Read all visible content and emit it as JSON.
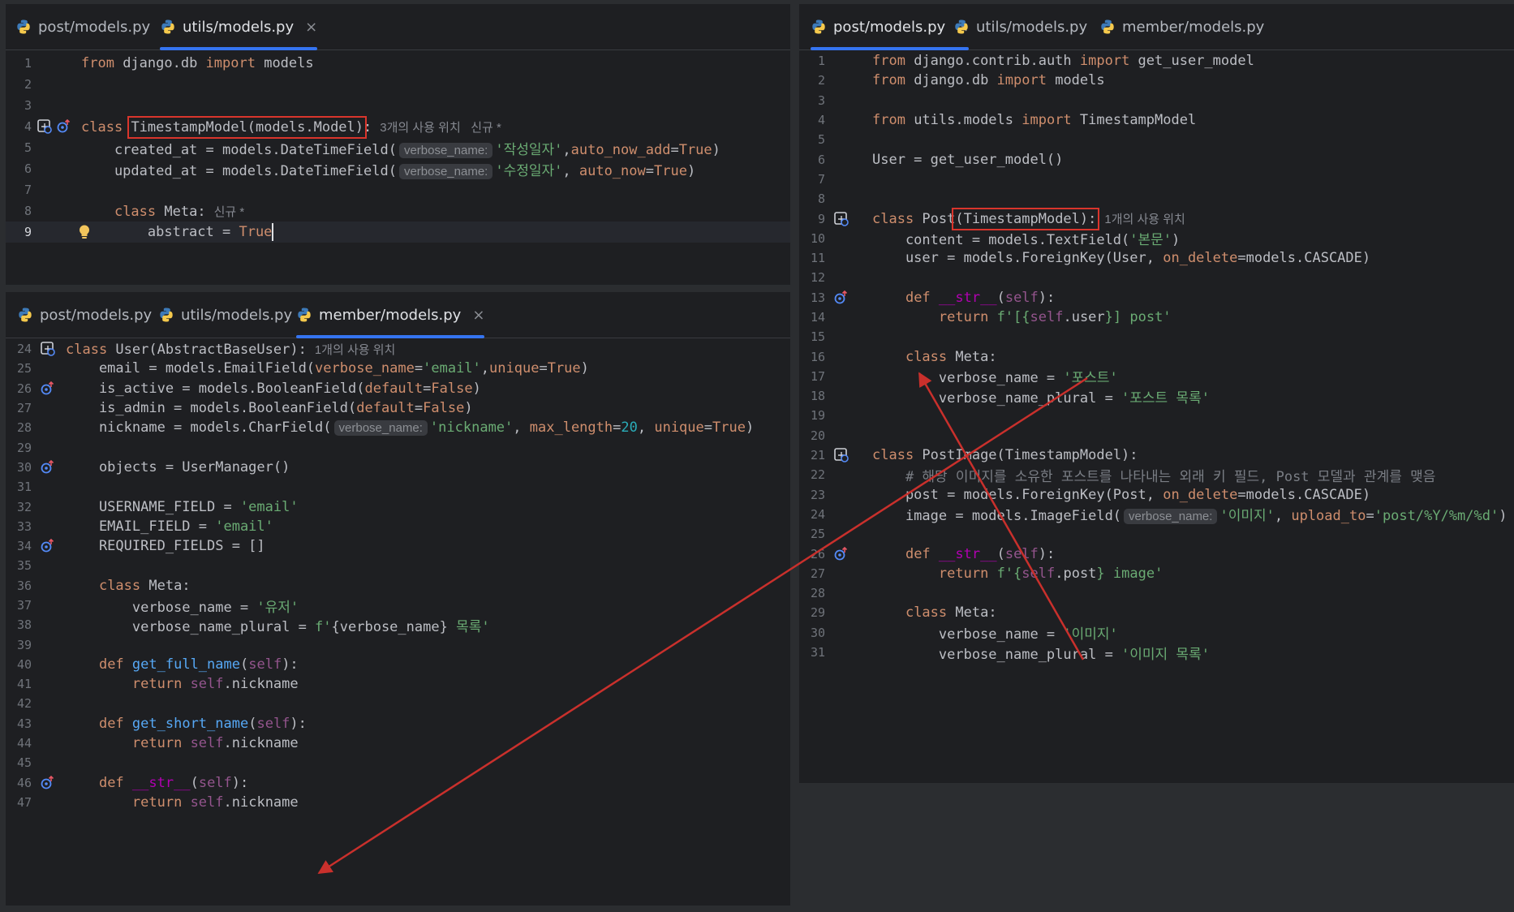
{
  "colors": {
    "accent": "#3574f0",
    "annotation_red": "#c9302c",
    "editor_bg": "#1e1f22",
    "keyword": "#cf8e6d",
    "string": "#6aab73"
  },
  "pane_a": {
    "tabs": [
      {
        "label": "post/models.py",
        "icon": "python-file-icon"
      },
      {
        "label": "utils/models.py",
        "icon": "python-file-icon",
        "close": "×"
      }
    ],
    "lines": [
      {
        "n": "1",
        "s": [
          {
            "t": "from",
            "c": "kw"
          },
          {
            "t": " django.db "
          },
          {
            "t": "import",
            "c": "kw"
          },
          {
            "t": " models"
          }
        ]
      },
      {
        "n": "2",
        "s": []
      },
      {
        "n": "3",
        "s": []
      },
      {
        "n": "4",
        "g": "structure",
        "s": [
          {
            "t": "class",
            "c": "kw"
          },
          {
            "t": " "
          },
          {
            "t": "TimestampModel(models.Model)",
            "hl": true
          },
          {
            "t": ":"
          },
          {
            "t": "3개의 사용 위치   신규 *",
            "c": "usage"
          }
        ]
      },
      {
        "n": "5",
        "s": [
          {
            "t": "    created_at = models.DateTimeField("
          },
          {
            "t": "verbose_name:",
            "c": "hint"
          },
          {
            "t": "'작성일자'",
            "c": "str"
          },
          {
            "t": ","
          },
          {
            "t": "auto_now_add",
            "c": "kw"
          },
          {
            "t": "="
          },
          {
            "t": "True",
            "c": "kw"
          },
          {
            "t": ")"
          }
        ]
      },
      {
        "n": "6",
        "s": [
          {
            "t": "    updated_at = models.DateTimeField("
          },
          {
            "t": "verbose_name:",
            "c": "hint"
          },
          {
            "t": "'수정일자'",
            "c": "str"
          },
          {
            "t": ", "
          },
          {
            "t": "auto_now",
            "c": "kw"
          },
          {
            "t": "="
          },
          {
            "t": "True",
            "c": "kw"
          },
          {
            "t": ")"
          }
        ]
      },
      {
        "n": "7",
        "s": []
      },
      {
        "n": "8",
        "s": [
          {
            "t": "    "
          },
          {
            "t": "class",
            "c": "kw"
          },
          {
            "t": " Meta:"
          },
          {
            "t": "신규 *",
            "c": "usage"
          }
        ]
      },
      {
        "n": "9",
        "current": true,
        "g": "bulb",
        "s": [
          {
            "t": "        abstract = "
          },
          {
            "t": "True",
            "c": "kw"
          },
          {
            "cursor": true
          }
        ]
      }
    ]
  },
  "pane_b": {
    "tabs": [
      {
        "label": "post/models.py",
        "icon": "python-file-icon"
      },
      {
        "label": "utils/models.py",
        "icon": "python-file-icon"
      },
      {
        "label": "member/models.py",
        "icon": "python-file-icon",
        "close": "×"
      }
    ],
    "lines": [
      {
        "n": "24",
        "g": "structure",
        "s": [
          {
            "t": "class",
            "c": "kw"
          },
          {
            "t": " User(AbstractBaseUser):"
          },
          {
            "t": "1개의 사용 위치",
            "c": "usage"
          }
        ]
      },
      {
        "n": "25",
        "s": [
          {
            "t": "    email = models.EmailField("
          },
          {
            "t": "verbose_name",
            "c": "kw"
          },
          {
            "t": "="
          },
          {
            "t": "'email'",
            "c": "str"
          },
          {
            "t": ","
          },
          {
            "t": "unique",
            "c": "kw"
          },
          {
            "t": "="
          },
          {
            "t": "True",
            "c": "kw"
          },
          {
            "t": ")"
          }
        ]
      },
      {
        "n": "26",
        "g": "override",
        "s": [
          {
            "t": "    is_active = models.BooleanField("
          },
          {
            "t": "default",
            "c": "kw"
          },
          {
            "t": "="
          },
          {
            "t": "False",
            "c": "kw"
          },
          {
            "t": ")"
          }
        ]
      },
      {
        "n": "27",
        "s": [
          {
            "t": "    is_admin = models.BooleanField("
          },
          {
            "t": "default",
            "c": "kw"
          },
          {
            "t": "="
          },
          {
            "t": "False",
            "c": "kw"
          },
          {
            "t": ")"
          }
        ]
      },
      {
        "n": "28",
        "s": [
          {
            "t": "    nickname = models.CharField("
          },
          {
            "t": "verbose_name:",
            "c": "hint"
          },
          {
            "t": "'nickname'",
            "c": "str"
          },
          {
            "t": ", "
          },
          {
            "t": "max_length",
            "c": "kw"
          },
          {
            "t": "="
          },
          {
            "t": "20",
            "c": "num"
          },
          {
            "t": ", "
          },
          {
            "t": "unique",
            "c": "kw"
          },
          {
            "t": "="
          },
          {
            "t": "True",
            "c": "kw"
          },
          {
            "t": ")"
          }
        ]
      },
      {
        "n": "29",
        "s": []
      },
      {
        "n": "30",
        "g": "override",
        "s": [
          {
            "t": "    objects = UserManager()"
          }
        ]
      },
      {
        "n": "31",
        "s": []
      },
      {
        "n": "32",
        "s": [
          {
            "t": "    USERNAME_FIELD = "
          },
          {
            "t": "'email'",
            "c": "str"
          }
        ]
      },
      {
        "n": "33",
        "s": [
          {
            "t": "    EMAIL_FIELD = "
          },
          {
            "t": "'email'",
            "c": "str"
          }
        ]
      },
      {
        "n": "34",
        "g": "override",
        "s": [
          {
            "t": "    REQUIRED_FIELDS = []"
          }
        ]
      },
      {
        "n": "35",
        "s": []
      },
      {
        "n": "36",
        "s": [
          {
            "t": "    "
          },
          {
            "t": "class",
            "c": "kw"
          },
          {
            "t": " Meta:"
          }
        ]
      },
      {
        "n": "37",
        "s": [
          {
            "t": "        verbose_name = "
          },
          {
            "t": "'유저'",
            "c": "str"
          }
        ]
      },
      {
        "n": "38",
        "s": [
          {
            "t": "        verbose_name_plural = "
          },
          {
            "t": "f'",
            "c": "str"
          },
          {
            "t": "{verbose_name}"
          },
          {
            "t": " 목록'",
            "c": "str"
          }
        ]
      },
      {
        "n": "39",
        "s": []
      },
      {
        "n": "40",
        "s": [
          {
            "t": "    "
          },
          {
            "t": "def",
            "c": "kw"
          },
          {
            "t": " "
          },
          {
            "t": "get_full_name",
            "c": "fn"
          },
          {
            "t": "("
          },
          {
            "t": "self",
            "c": "self"
          },
          {
            "t": "):"
          }
        ]
      },
      {
        "n": "41",
        "s": [
          {
            "t": "        "
          },
          {
            "t": "return",
            "c": "kw"
          },
          {
            "t": " "
          },
          {
            "t": "self",
            "c": "self"
          },
          {
            "t": ".nickname"
          }
        ]
      },
      {
        "n": "42",
        "s": []
      },
      {
        "n": "43",
        "s": [
          {
            "t": "    "
          },
          {
            "t": "def",
            "c": "kw"
          },
          {
            "t": " "
          },
          {
            "t": "get_short_name",
            "c": "fn"
          },
          {
            "t": "("
          },
          {
            "t": "self",
            "c": "self"
          },
          {
            "t": "):"
          }
        ]
      },
      {
        "n": "44",
        "s": [
          {
            "t": "        "
          },
          {
            "t": "return",
            "c": "kw"
          },
          {
            "t": " "
          },
          {
            "t": "self",
            "c": "self"
          },
          {
            "t": ".nickname"
          }
        ]
      },
      {
        "n": "45",
        "s": []
      },
      {
        "n": "46",
        "g": "override",
        "s": [
          {
            "t": "    "
          },
          {
            "t": "def",
            "c": "kw"
          },
          {
            "t": " "
          },
          {
            "t": "__str__",
            "c": "mg"
          },
          {
            "t": "("
          },
          {
            "t": "self",
            "c": "self"
          },
          {
            "t": "):"
          }
        ]
      },
      {
        "n": "47",
        "s": [
          {
            "t": "        "
          },
          {
            "t": "return",
            "c": "kw"
          },
          {
            "t": " "
          },
          {
            "t": "self",
            "c": "self"
          },
          {
            "t": ".nickname"
          }
        ]
      }
    ]
  },
  "pane_c": {
    "tabs": [
      {
        "label": "post/models.py",
        "icon": "python-file-icon",
        "close": "×"
      },
      {
        "label": "utils/models.py",
        "icon": "python-file-icon"
      },
      {
        "label": "member/models.py",
        "icon": "python-file-icon"
      }
    ],
    "lines": [
      {
        "n": "1",
        "s": [
          {
            "t": "from",
            "c": "kw"
          },
          {
            "t": " django.contrib.auth "
          },
          {
            "t": "import",
            "c": "kw"
          },
          {
            "t": " get_user_model"
          }
        ]
      },
      {
        "n": "2",
        "s": [
          {
            "t": "from",
            "c": "kw"
          },
          {
            "t": " django.db "
          },
          {
            "t": "import",
            "c": "kw"
          },
          {
            "t": " models"
          }
        ]
      },
      {
        "n": "3",
        "s": []
      },
      {
        "n": "4",
        "s": [
          {
            "t": "from",
            "c": "kw"
          },
          {
            "t": " utils.models "
          },
          {
            "t": "import",
            "c": "kw"
          },
          {
            "t": " TimestampModel"
          }
        ]
      },
      {
        "n": "5",
        "s": []
      },
      {
        "n": "6",
        "s": [
          {
            "t": "User = get_user_model()"
          }
        ]
      },
      {
        "n": "7",
        "s": []
      },
      {
        "n": "8",
        "s": []
      },
      {
        "n": "9",
        "g": "structure",
        "s": [
          {
            "t": "class",
            "c": "kw"
          },
          {
            "t": " Post"
          },
          {
            "t": "(TimestampModel):",
            "hl": true
          },
          {
            "t": "1개의 사용 위치",
            "c": "usage"
          }
        ]
      },
      {
        "n": "10",
        "s": [
          {
            "t": "    content = models.TextField("
          },
          {
            "t": "'본문'",
            "c": "str"
          },
          {
            "t": ")"
          }
        ]
      },
      {
        "n": "11",
        "s": [
          {
            "t": "    user = models.ForeignKey(User, "
          },
          {
            "t": "on_delete",
            "c": "kw"
          },
          {
            "t": "=models.CASCADE)"
          }
        ]
      },
      {
        "n": "12",
        "s": []
      },
      {
        "n": "13",
        "g": "override",
        "s": [
          {
            "t": "    "
          },
          {
            "t": "def",
            "c": "kw"
          },
          {
            "t": " "
          },
          {
            "t": "__str__",
            "c": "mg"
          },
          {
            "t": "("
          },
          {
            "t": "self",
            "c": "self"
          },
          {
            "t": "):"
          }
        ]
      },
      {
        "n": "14",
        "s": [
          {
            "t": "        "
          },
          {
            "t": "return",
            "c": "kw"
          },
          {
            "t": " "
          },
          {
            "t": "f'[{",
            "c": "str"
          },
          {
            "t": "self",
            "c": "self"
          },
          {
            "t": ".user"
          },
          {
            "t": "}] post'",
            "c": "str"
          }
        ]
      },
      {
        "n": "15",
        "s": []
      },
      {
        "n": "16",
        "s": [
          {
            "t": "    "
          },
          {
            "t": "class",
            "c": "kw"
          },
          {
            "t": " Meta:"
          }
        ]
      },
      {
        "n": "17",
        "s": [
          {
            "t": "        verbose_name = "
          },
          {
            "t": "'포스트'",
            "c": "str"
          }
        ]
      },
      {
        "n": "18",
        "s": [
          {
            "t": "        verbose_name_plural = "
          },
          {
            "t": "'포스트 목록'",
            "c": "str"
          }
        ]
      },
      {
        "n": "19",
        "s": []
      },
      {
        "n": "20",
        "s": []
      },
      {
        "n": "21",
        "g": "structure",
        "s": [
          {
            "t": "class",
            "c": "kw"
          },
          {
            "t": " PostImage(TimestampModel):"
          }
        ]
      },
      {
        "n": "22",
        "s": [
          {
            "t": "    # 해당 이미지를 소유한 포스트를 나타내는 외래 키 필드, Post 모델과 관계를 맺음",
            "c": "com"
          }
        ]
      },
      {
        "n": "23",
        "s": [
          {
            "t": "    post = models.ForeignKey(Post, "
          },
          {
            "t": "on_delete",
            "c": "kw"
          },
          {
            "t": "=models.CASCADE)"
          }
        ]
      },
      {
        "n": "24",
        "s": [
          {
            "t": "    image = models.ImageField("
          },
          {
            "t": "verbose_name:",
            "c": "hint"
          },
          {
            "t": "'이미지'",
            "c": "str"
          },
          {
            "t": ", "
          },
          {
            "t": "upload_to",
            "c": "kw"
          },
          {
            "t": "="
          },
          {
            "t": "'post/%Y/%m/%d'",
            "c": "str"
          },
          {
            "t": ")"
          }
        ]
      },
      {
        "n": "25",
        "s": []
      },
      {
        "n": "26",
        "g": "override",
        "s": [
          {
            "t": "    "
          },
          {
            "t": "def",
            "c": "kw"
          },
          {
            "t": " "
          },
          {
            "t": "__str__",
            "c": "mg"
          },
          {
            "t": "("
          },
          {
            "t": "self",
            "c": "self"
          },
          {
            "t": "):"
          }
        ]
      },
      {
        "n": "27",
        "s": [
          {
            "t": "        "
          },
          {
            "t": "return",
            "c": "kw"
          },
          {
            "t": " "
          },
          {
            "t": "f'{",
            "c": "str"
          },
          {
            "t": "self",
            "c": "self"
          },
          {
            "t": ".post"
          },
          {
            "t": "} image'",
            "c": "str"
          }
        ]
      },
      {
        "n": "28",
        "s": []
      },
      {
        "n": "29",
        "s": [
          {
            "t": "    "
          },
          {
            "t": "class",
            "c": "kw"
          },
          {
            "t": " Meta:"
          }
        ]
      },
      {
        "n": "30",
        "s": [
          {
            "t": "        verbose_name = "
          },
          {
            "t": "'이미지'",
            "c": "str"
          }
        ]
      },
      {
        "n": "31",
        "s": [
          {
            "t": "        verbose_name_plural = "
          },
          {
            "t": "'이미지 목록'",
            "c": "str"
          }
        ]
      }
    ]
  }
}
